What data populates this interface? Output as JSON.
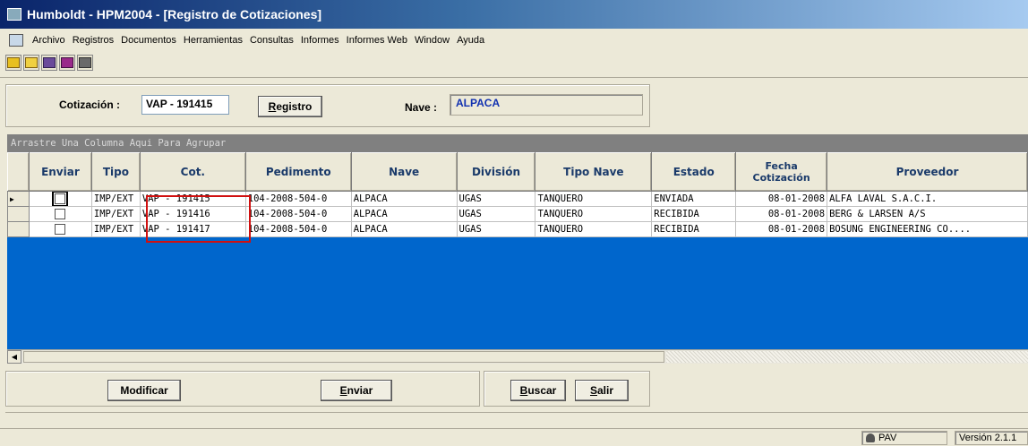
{
  "window": {
    "title": "Humboldt - HPM2004 - [Registro de Cotizaciones]",
    "app_icon": "window-app-icon"
  },
  "menu": [
    "Archivo",
    "Registros",
    "Documentos",
    "Herramientas",
    "Consultas",
    "Informes",
    "Informes Web",
    "Window",
    "Ayuda"
  ],
  "toolbar": {
    "icons": [
      "new-doc-icon",
      "open-folder-icon",
      "print-icon",
      "calendar-icon",
      "exit-door-icon"
    ],
    "colors": [
      "#e8c020",
      "#f0d040",
      "#6a4a9a",
      "#9a2a8a",
      "#6a6a6a"
    ]
  },
  "form": {
    "cotizacion_label": "Cotización :",
    "cotizacion_value": "VAP - 191415",
    "registro_button_underline": "R",
    "registro_button_rest": "egistro",
    "nave_label": "Nave :",
    "nave_value": "ALPACA"
  },
  "grid": {
    "group_hint": "Arrastre Una Columna Aqui Para Agrupar",
    "headers": {
      "enviar": "Enviar",
      "tipo": "Tipo",
      "cot": "Cot.",
      "pedimento": "Pedimento",
      "nave": "Nave",
      "division": "División",
      "tipo_nave": "Tipo Nave",
      "estado": "Estado",
      "fecha_line1": "Fecha",
      "fecha_line2": "Cotización",
      "proveedor": "Proveedor"
    },
    "rows": [
      {
        "enviar": false,
        "tipo": "IMP/EXT",
        "cot": "VAP - 191415",
        "pedimento": "104-2008-504-0",
        "nave": "ALPACA",
        "division": "UGAS",
        "tipo_nave": "TANQUERO",
        "estado": "ENVIADA",
        "fecha": "08-01-2008",
        "proveedor": "ALFA LAVAL S.A.C.I."
      },
      {
        "enviar": false,
        "tipo": "IMP/EXT",
        "cot": "VAP - 191416",
        "pedimento": "104-2008-504-0",
        "nave": "ALPACA",
        "division": "UGAS",
        "tipo_nave": "TANQUERO",
        "estado": "RECIBIDA",
        "fecha": "08-01-2008",
        "proveedor": "BERG & LARSEN A/S"
      },
      {
        "enviar": false,
        "tipo": "IMP/EXT",
        "cot": "VAP - 191417",
        "pedimento": "104-2008-504-0",
        "nave": "ALPACA",
        "division": "UGAS",
        "tipo_nave": "TANQUERO",
        "estado": "RECIBIDA",
        "fecha": "08-01-2008",
        "proveedor": "BOSUNG ENGINEERING CO...."
      }
    ]
  },
  "buttons": {
    "modificar": "Modificar",
    "enviar_u": "E",
    "enviar_rest": "nviar",
    "buscar_u": "B",
    "buscar_rest": "uscar",
    "salir_u": "S",
    "salir_rest": "alir"
  },
  "status": {
    "user": "PAV",
    "version": "Versión 2.1.1"
  },
  "colors": {
    "grid_background": "#0066cc",
    "highlight_box": "#d01010",
    "nave_text": "#1030b0"
  }
}
